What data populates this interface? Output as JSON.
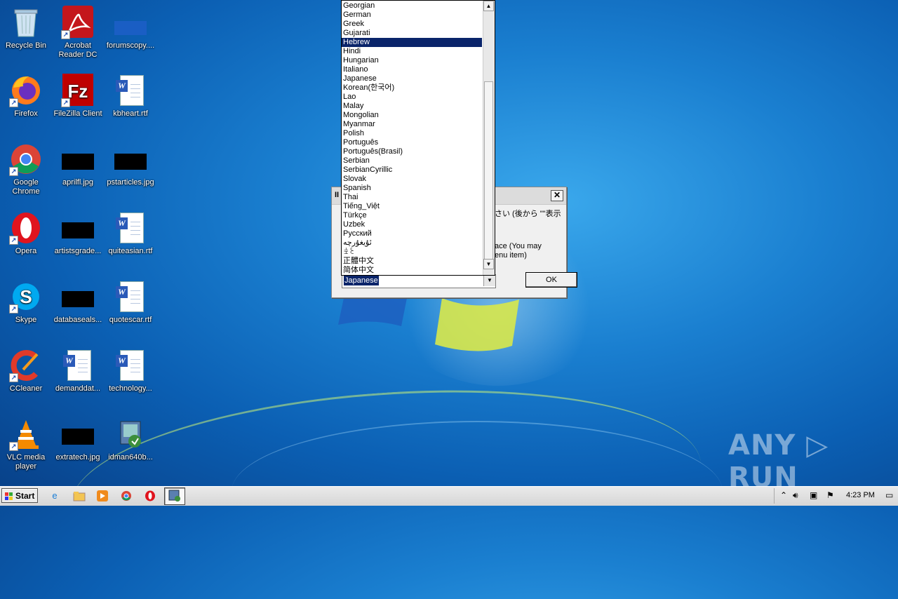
{
  "desktop": {
    "icons": [
      {
        "label": "Recycle Bin"
      },
      {
        "label": "Acrobat Reader DC"
      },
      {
        "label": "forumscopy...."
      },
      {
        "label": "Firefox"
      },
      {
        "label": "FileZilla Client"
      },
      {
        "label": "kbheart.rtf"
      },
      {
        "label": "Google Chrome"
      },
      {
        "label": "aprilfl.jpg"
      },
      {
        "label": "pstarticles.jpg"
      },
      {
        "label": "Opera"
      },
      {
        "label": "artistsgrade..."
      },
      {
        "label": "quiteasian.rtf"
      },
      {
        "label": "Skype"
      },
      {
        "label": "databaseals..."
      },
      {
        "label": "quotescar.rtf"
      },
      {
        "label": "CCleaner"
      },
      {
        "label": "demanddat..."
      },
      {
        "label": "technology..."
      },
      {
        "label": "VLC media player"
      },
      {
        "label": "extratech.jpg"
      },
      {
        "label": "idman640b..."
      }
    ]
  },
  "dialog": {
    "title_fragment": "II",
    "text_line1": "さい (後から \"\"表示",
    "text_line2": "ace (You may",
    "text_line3": "enu item)",
    "ok_label": "OK",
    "close_glyph": "✕",
    "language_combo": {
      "selected_value": "Japanese",
      "highlighted_item": "Hebrew",
      "options": [
        "Georgian",
        "German",
        "Greek",
        "Gujarati",
        "Hebrew",
        "Hindi",
        "Hungarian",
        "Italiano",
        "Japanese",
        "Korean(한국어)",
        "Lao",
        "Malay",
        "Mongolian",
        "Myanmar",
        "Polish",
        "Português",
        "Português(Brasil)",
        "Serbian",
        "SerbianCyrillic",
        "Slovak",
        "Spanish",
        "Thai",
        "Tiếng_Việt",
        "Türkçe",
        "Uzbek",
        "Русский",
        "ئۇيغۇرچە",
        "ꀨꏂ",
        "正體中文",
        "简体中文"
      ]
    }
  },
  "taskbar": {
    "start_label": "Start",
    "clock": "4:23 PM"
  },
  "watermark": "ANY ▷ RUN",
  "colors": {
    "selection": "#0a246a",
    "desktop": "#1a7fd0"
  }
}
